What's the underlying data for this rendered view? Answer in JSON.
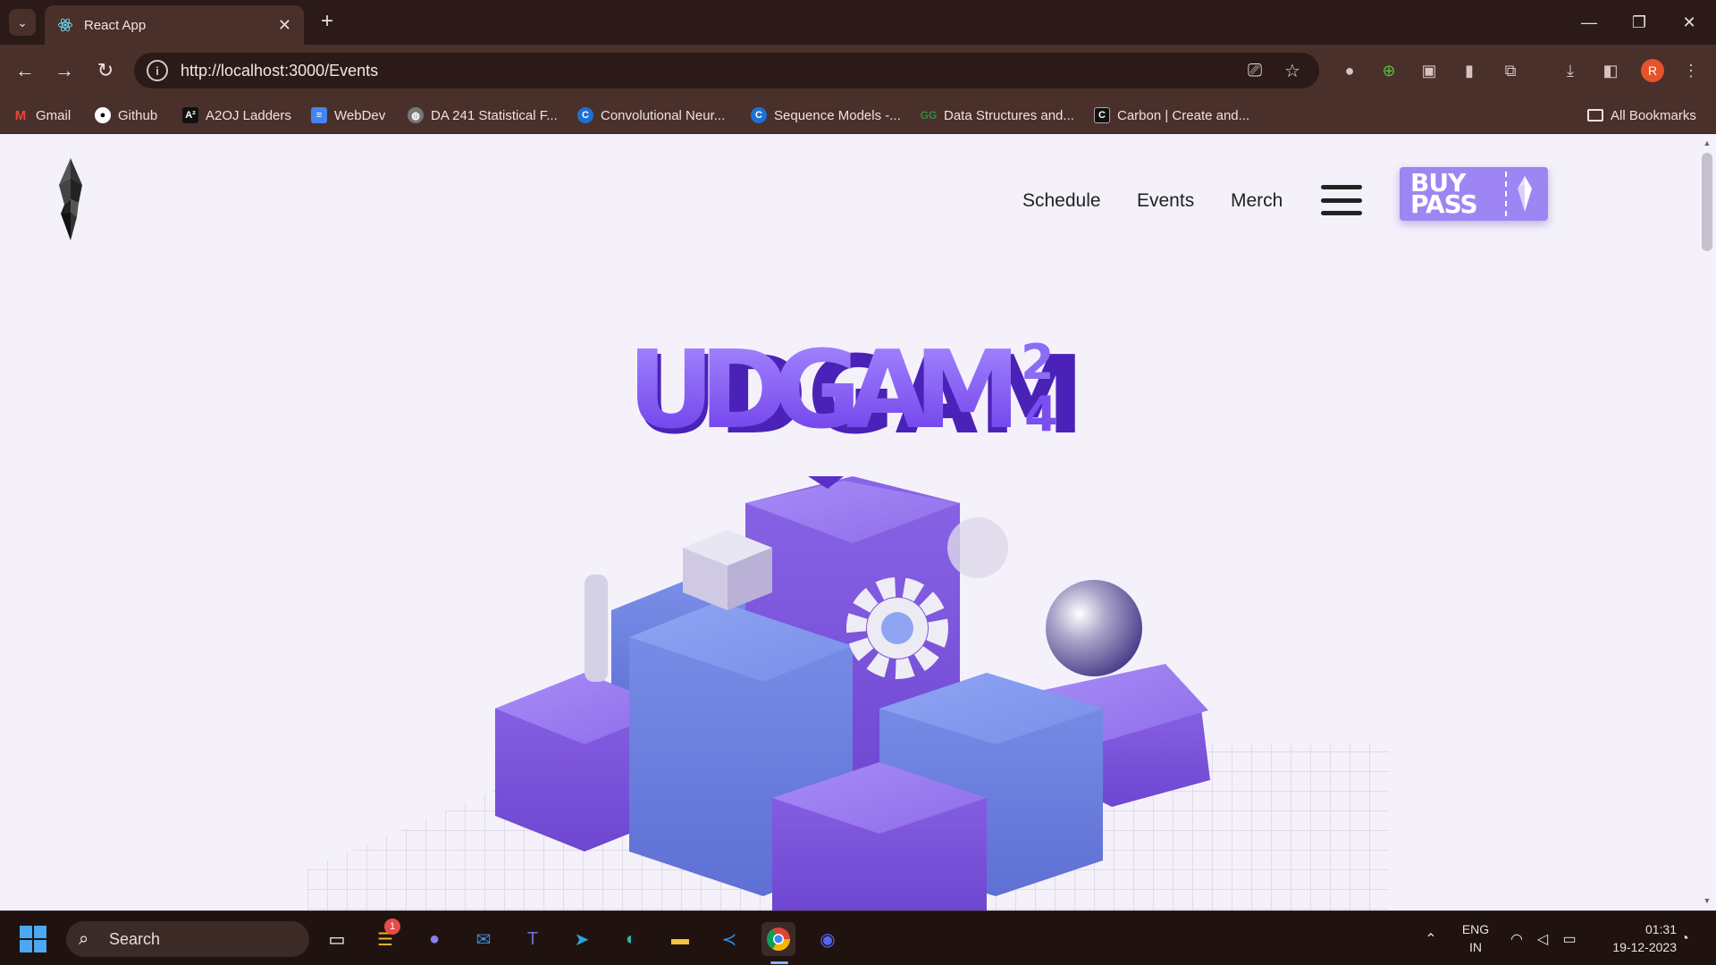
{
  "browser": {
    "tab_title": "React App",
    "url": "http://localhost:3000/Events",
    "profile_initial": "R",
    "bookmarks": [
      {
        "label": "Gmail",
        "icon": "gmail-icon"
      },
      {
        "label": "Github",
        "icon": "github-icon"
      },
      {
        "label": "A2OJ Ladders",
        "icon": "a2oj-icon"
      },
      {
        "label": "WebDev",
        "icon": "docs-icon"
      },
      {
        "label": "DA 241 Statistical F...",
        "icon": "globe-icon"
      },
      {
        "label": "Convolutional Neur...",
        "icon": "coursera-icon"
      },
      {
        "label": "Sequence Models -...",
        "icon": "coursera-icon"
      },
      {
        "label": "Data Structures and...",
        "icon": "gfg-icon"
      },
      {
        "label": "Carbon | Create and...",
        "icon": "carbon-icon"
      }
    ],
    "all_bookmarks": "All Bookmarks"
  },
  "site": {
    "nav": {
      "schedule": "Schedule",
      "events": "Events",
      "merch": "Merch"
    },
    "buy_pass": "BUY PASS",
    "hero_title": "UDGAM",
    "hero_superscript_top": "2",
    "hero_superscript_bottom": "4"
  },
  "taskbar": {
    "search_label": "Search",
    "notification_count": "1",
    "lang_top": "ENG",
    "lang_bottom": "IN",
    "time": "01:31",
    "date": "19-12-2023"
  },
  "colors": {
    "accent_purple": "#9d86f3",
    "title_purple": "#7a4ff0",
    "browser_frame": "#4a302a"
  }
}
